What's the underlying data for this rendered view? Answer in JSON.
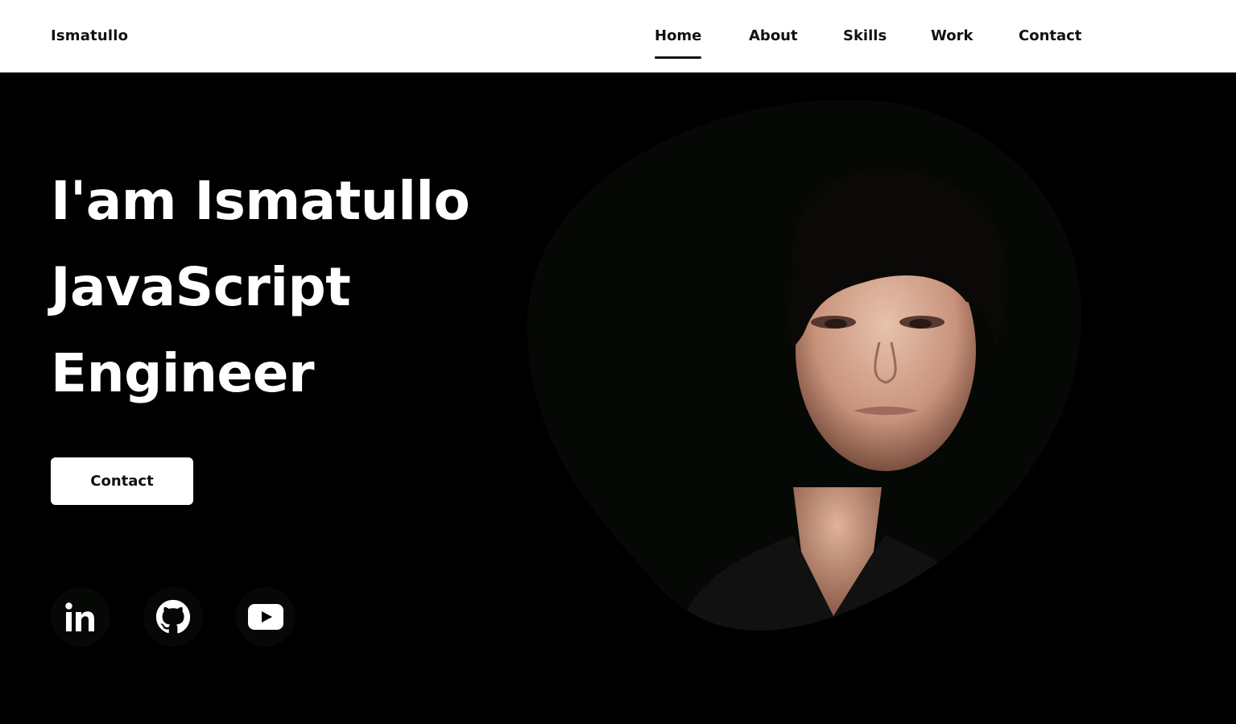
{
  "header": {
    "logo": "Ismatullo",
    "nav": [
      {
        "label": "Home",
        "active": true
      },
      {
        "label": "About",
        "active": false
      },
      {
        "label": "Skills",
        "active": false
      },
      {
        "label": "Work",
        "active": false
      },
      {
        "label": "Contact",
        "active": false
      }
    ]
  },
  "hero": {
    "title_lines": [
      "I'am Ismatullo",
      "JavaScript",
      "Engineer"
    ],
    "cta_label": "Contact",
    "social": [
      {
        "icon": "linkedin-icon"
      },
      {
        "icon": "github-icon"
      },
      {
        "icon": "youtube-icon"
      }
    ],
    "portrait_icon": "profile-photo"
  },
  "colors": {
    "background": "#000000",
    "header_bg": "#ffffff",
    "text_dark": "#111111",
    "text_light": "#ffffff",
    "blob": "#050805"
  }
}
